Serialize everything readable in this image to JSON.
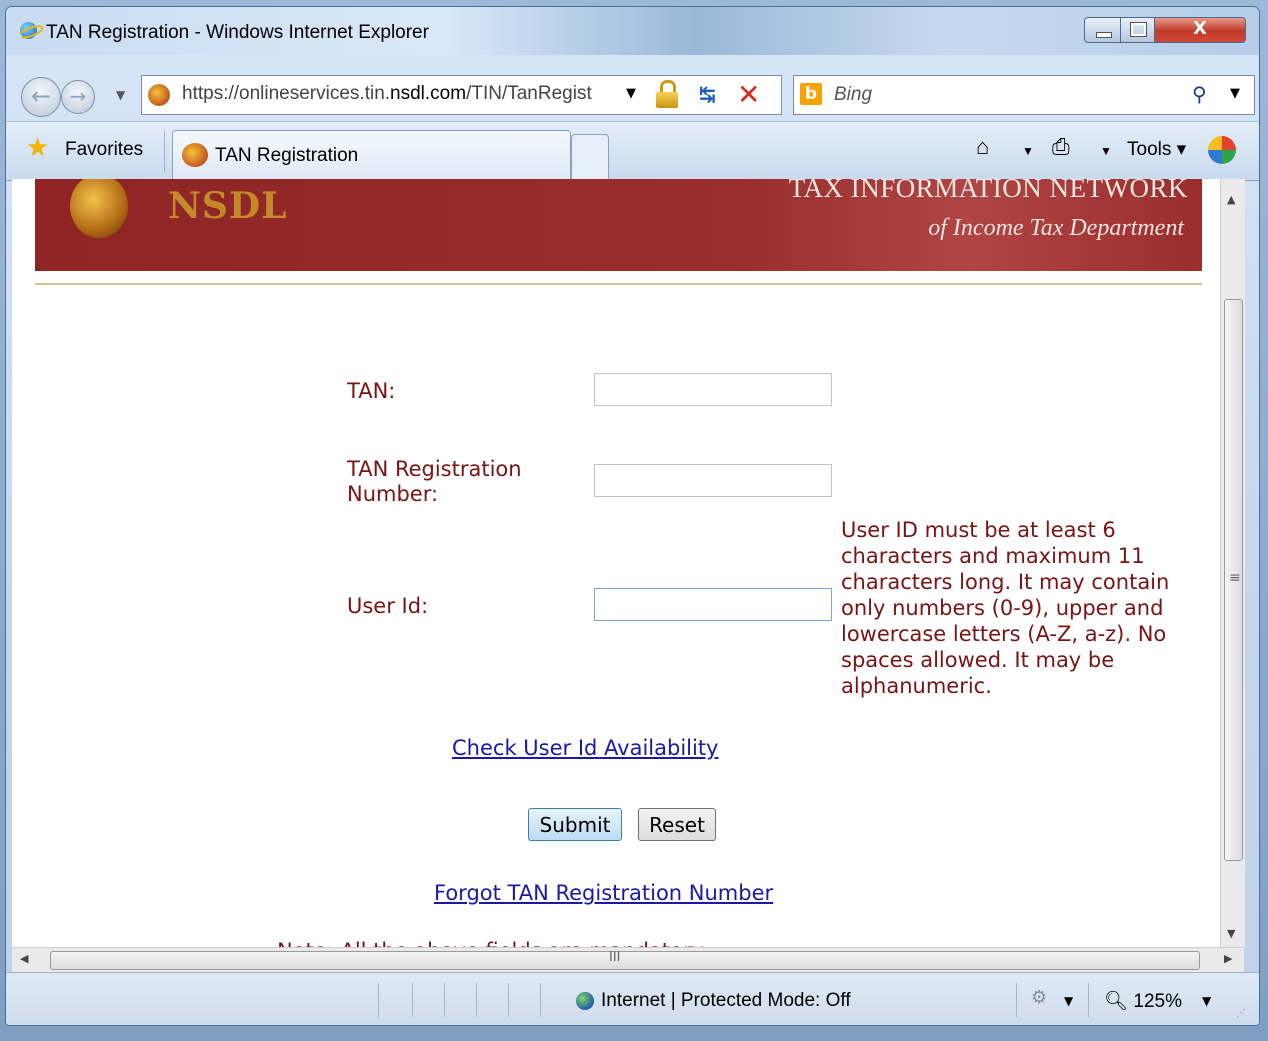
{
  "window": {
    "title": "TAN Registration - Windows Internet Explorer",
    "close_glyph": "X"
  },
  "nav": {
    "back_glyph": "←",
    "forward_glyph": "→",
    "address_prefix": "https://onlineservices.tin.",
    "address_domain": "nsdl.com",
    "address_path": "/TIN/TanRegist",
    "search_placeholder": "Bing",
    "search_logo": "b"
  },
  "favorites_bar": {
    "favorites_label": "Favorites",
    "tab_label": "TAN Registration",
    "tools_label": "Tools ▾"
  },
  "banner": {
    "brand": "NSDL",
    "title": "TAX INFORMATION NETWORK",
    "subtitle": "of Income Tax Department"
  },
  "form": {
    "tan_label": "TAN:",
    "tan_value": "",
    "tan_reg_label": "TAN Registration Number:",
    "tan_reg_value": "",
    "user_id_label": "User Id:",
    "user_id_value": "",
    "user_id_hint": "User ID must be at least 6 characters and maximum 11 characters long. It may contain only numbers (0-9), upper and lowercase letters (A-Z, a-z). No spaces allowed. It may be alphanumeric.",
    "check_link": "Check User Id Availability",
    "submit_label": "Submit",
    "reset_label": "Reset",
    "forgot_link": "Forgot TAN Registration Number",
    "note": "Note: All the above fields are mandatory"
  },
  "scrollbars": {
    "vertical_grip": "≡",
    "horizontal_grip": "III"
  },
  "status_bar": {
    "zone_text": "Internet | Protected Mode: Off",
    "zoom_text": " 125%"
  },
  "colors": {
    "banner_bg": "#9a2d2d",
    "label_text": "#7a1414",
    "link": "#1a1aa6"
  },
  "icons": [
    "ie-logo-icon",
    "back-arrow-icon",
    "forward-arrow-icon",
    "site-favicon-icon",
    "lock-icon",
    "refresh-icon",
    "stop-icon",
    "bing-icon",
    "search-icon",
    "favorites-star-icon",
    "home-icon",
    "print-icon",
    "help-icon",
    "globe-icon",
    "security-icon",
    "zoom-icon"
  ]
}
